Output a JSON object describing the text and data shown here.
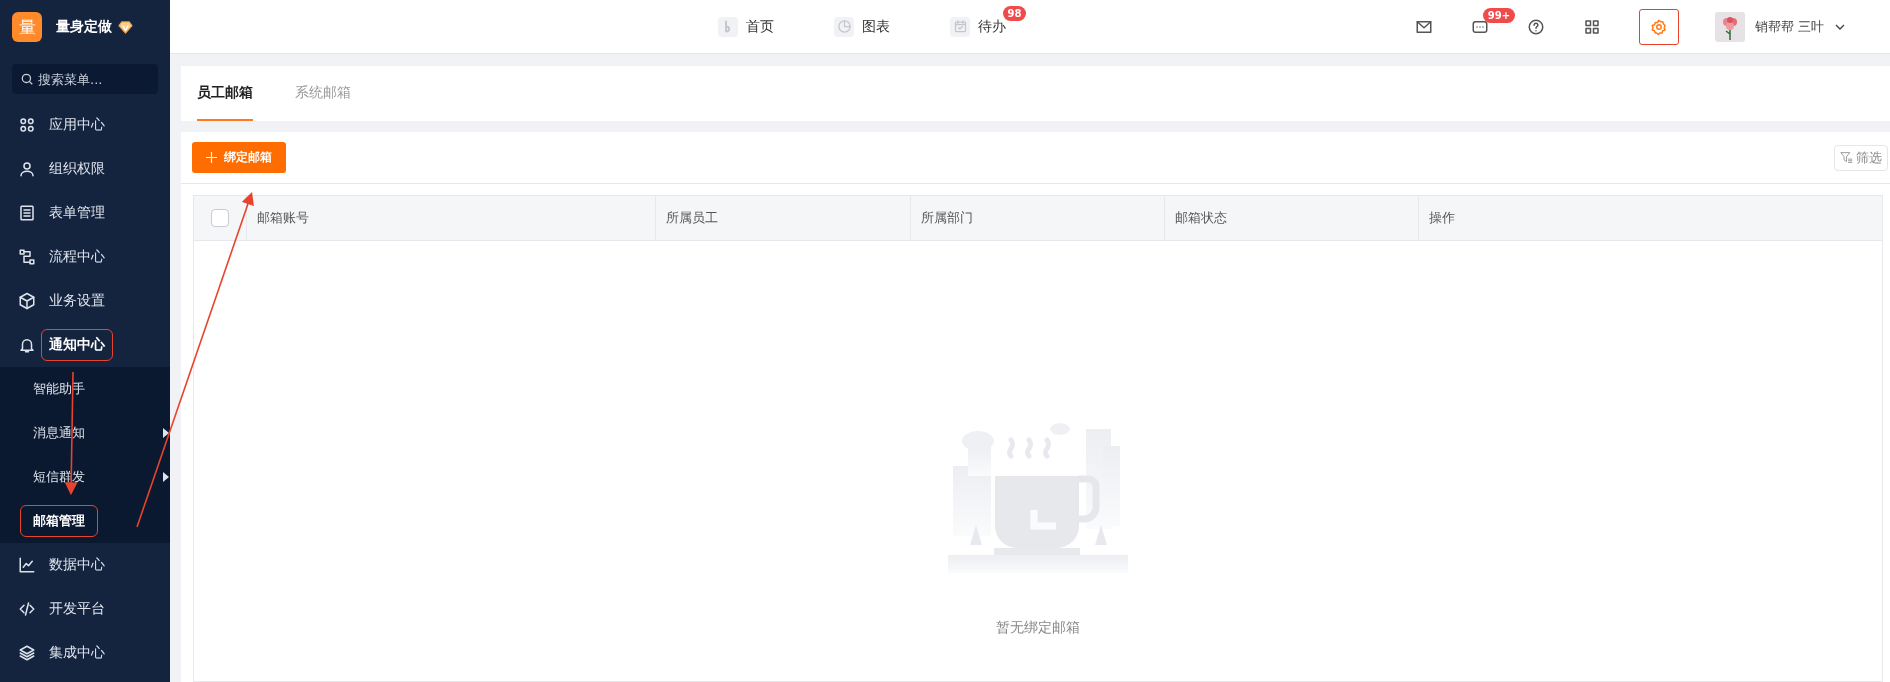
{
  "brand": {
    "logo": "量",
    "name": "量身定做"
  },
  "search": {
    "placeholder": "搜索菜单..."
  },
  "sidebar": {
    "items": [
      {
        "label": "应用中心",
        "highlighted": false
      },
      {
        "label": "组织权限",
        "highlighted": false
      },
      {
        "label": "表单管理",
        "highlighted": false
      },
      {
        "label": "流程中心",
        "highlighted": false
      },
      {
        "label": "业务设置",
        "highlighted": false
      },
      {
        "label": "通知中心",
        "highlighted": true,
        "children": [
          {
            "label": "智能助手",
            "selected": false,
            "has_submenu": false,
            "highlighted": false
          },
          {
            "label": "消息通知",
            "selected": false,
            "has_submenu": true,
            "highlighted": false
          },
          {
            "label": "短信群发",
            "selected": false,
            "has_submenu": true,
            "highlighted": false
          },
          {
            "label": "邮箱管理",
            "selected": true,
            "has_submenu": false,
            "highlighted": true
          }
        ]
      },
      {
        "label": "数据中心",
        "highlighted": false
      },
      {
        "label": "开发平台",
        "highlighted": false
      },
      {
        "label": "集成中心",
        "highlighted": false
      }
    ]
  },
  "top_nav": [
    {
      "label": "首页"
    },
    {
      "label": "图表"
    },
    {
      "label": "待办",
      "badge": "98"
    }
  ],
  "toolbar": {
    "chat_badge": "99+",
    "settings_highlighted": true,
    "user_name": "销帮帮 三叶"
  },
  "tabs": [
    {
      "label": "员工邮箱",
      "selected": true
    },
    {
      "label": "系统邮箱",
      "selected": false
    }
  ],
  "actions": {
    "add_button": "绑定邮箱",
    "filter_button": "筛选"
  },
  "table": {
    "select_all": false,
    "columns": [
      "邮箱账号",
      "所属员工",
      "所属部门",
      "邮箱状态",
      "操作"
    ],
    "empty_text": "暂无绑定邮箱"
  }
}
